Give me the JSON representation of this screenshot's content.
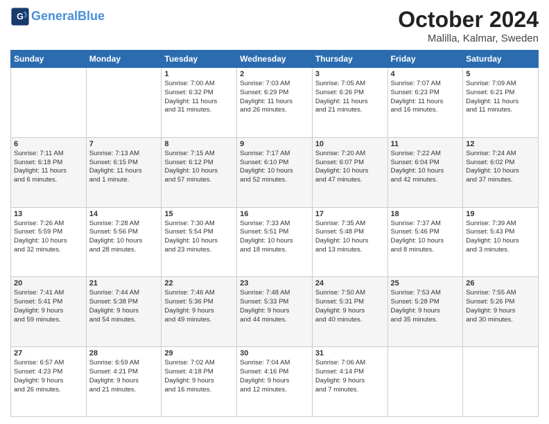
{
  "header": {
    "logo_line1": "General",
    "logo_line2": "Blue",
    "month": "October 2024",
    "location": "Malilla, Kalmar, Sweden"
  },
  "days_of_week": [
    "Sunday",
    "Monday",
    "Tuesday",
    "Wednesday",
    "Thursday",
    "Friday",
    "Saturday"
  ],
  "weeks": [
    [
      {
        "num": "",
        "info": ""
      },
      {
        "num": "",
        "info": ""
      },
      {
        "num": "1",
        "info": "Sunrise: 7:00 AM\nSunset: 6:32 PM\nDaylight: 11 hours\nand 31 minutes."
      },
      {
        "num": "2",
        "info": "Sunrise: 7:03 AM\nSunset: 6:29 PM\nDaylight: 11 hours\nand 26 minutes."
      },
      {
        "num": "3",
        "info": "Sunrise: 7:05 AM\nSunset: 6:26 PM\nDaylight: 11 hours\nand 21 minutes."
      },
      {
        "num": "4",
        "info": "Sunrise: 7:07 AM\nSunset: 6:23 PM\nDaylight: 11 hours\nand 16 minutes."
      },
      {
        "num": "5",
        "info": "Sunrise: 7:09 AM\nSunset: 6:21 PM\nDaylight: 11 hours\nand 11 minutes."
      }
    ],
    [
      {
        "num": "6",
        "info": "Sunrise: 7:11 AM\nSunset: 6:18 PM\nDaylight: 11 hours\nand 6 minutes."
      },
      {
        "num": "7",
        "info": "Sunrise: 7:13 AM\nSunset: 6:15 PM\nDaylight: 11 hours\nand 1 minute."
      },
      {
        "num": "8",
        "info": "Sunrise: 7:15 AM\nSunset: 6:12 PM\nDaylight: 10 hours\nand 57 minutes."
      },
      {
        "num": "9",
        "info": "Sunrise: 7:17 AM\nSunset: 6:10 PM\nDaylight: 10 hours\nand 52 minutes."
      },
      {
        "num": "10",
        "info": "Sunrise: 7:20 AM\nSunset: 6:07 PM\nDaylight: 10 hours\nand 47 minutes."
      },
      {
        "num": "11",
        "info": "Sunrise: 7:22 AM\nSunset: 6:04 PM\nDaylight: 10 hours\nand 42 minutes."
      },
      {
        "num": "12",
        "info": "Sunrise: 7:24 AM\nSunset: 6:02 PM\nDaylight: 10 hours\nand 37 minutes."
      }
    ],
    [
      {
        "num": "13",
        "info": "Sunrise: 7:26 AM\nSunset: 5:59 PM\nDaylight: 10 hours\nand 32 minutes."
      },
      {
        "num": "14",
        "info": "Sunrise: 7:28 AM\nSunset: 5:56 PM\nDaylight: 10 hours\nand 28 minutes."
      },
      {
        "num": "15",
        "info": "Sunrise: 7:30 AM\nSunset: 5:54 PM\nDaylight: 10 hours\nand 23 minutes."
      },
      {
        "num": "16",
        "info": "Sunrise: 7:33 AM\nSunset: 5:51 PM\nDaylight: 10 hours\nand 18 minutes."
      },
      {
        "num": "17",
        "info": "Sunrise: 7:35 AM\nSunset: 5:48 PM\nDaylight: 10 hours\nand 13 minutes."
      },
      {
        "num": "18",
        "info": "Sunrise: 7:37 AM\nSunset: 5:46 PM\nDaylight: 10 hours\nand 8 minutes."
      },
      {
        "num": "19",
        "info": "Sunrise: 7:39 AM\nSunset: 5:43 PM\nDaylight: 10 hours\nand 3 minutes."
      }
    ],
    [
      {
        "num": "20",
        "info": "Sunrise: 7:41 AM\nSunset: 5:41 PM\nDaylight: 9 hours\nand 59 minutes."
      },
      {
        "num": "21",
        "info": "Sunrise: 7:44 AM\nSunset: 5:38 PM\nDaylight: 9 hours\nand 54 minutes."
      },
      {
        "num": "22",
        "info": "Sunrise: 7:46 AM\nSunset: 5:36 PM\nDaylight: 9 hours\nand 49 minutes."
      },
      {
        "num": "23",
        "info": "Sunrise: 7:48 AM\nSunset: 5:33 PM\nDaylight: 9 hours\nand 44 minutes."
      },
      {
        "num": "24",
        "info": "Sunrise: 7:50 AM\nSunset: 5:31 PM\nDaylight: 9 hours\nand 40 minutes."
      },
      {
        "num": "25",
        "info": "Sunrise: 7:53 AM\nSunset: 5:28 PM\nDaylight: 9 hours\nand 35 minutes."
      },
      {
        "num": "26",
        "info": "Sunrise: 7:55 AM\nSunset: 5:26 PM\nDaylight: 9 hours\nand 30 minutes."
      }
    ],
    [
      {
        "num": "27",
        "info": "Sunrise: 6:57 AM\nSunset: 4:23 PM\nDaylight: 9 hours\nand 26 minutes."
      },
      {
        "num": "28",
        "info": "Sunrise: 6:59 AM\nSunset: 4:21 PM\nDaylight: 9 hours\nand 21 minutes."
      },
      {
        "num": "29",
        "info": "Sunrise: 7:02 AM\nSunset: 4:18 PM\nDaylight: 9 hours\nand 16 minutes."
      },
      {
        "num": "30",
        "info": "Sunrise: 7:04 AM\nSunset: 4:16 PM\nDaylight: 9 hours\nand 12 minutes."
      },
      {
        "num": "31",
        "info": "Sunrise: 7:06 AM\nSunset: 4:14 PM\nDaylight: 9 hours\nand 7 minutes."
      },
      {
        "num": "",
        "info": ""
      },
      {
        "num": "",
        "info": ""
      }
    ]
  ]
}
